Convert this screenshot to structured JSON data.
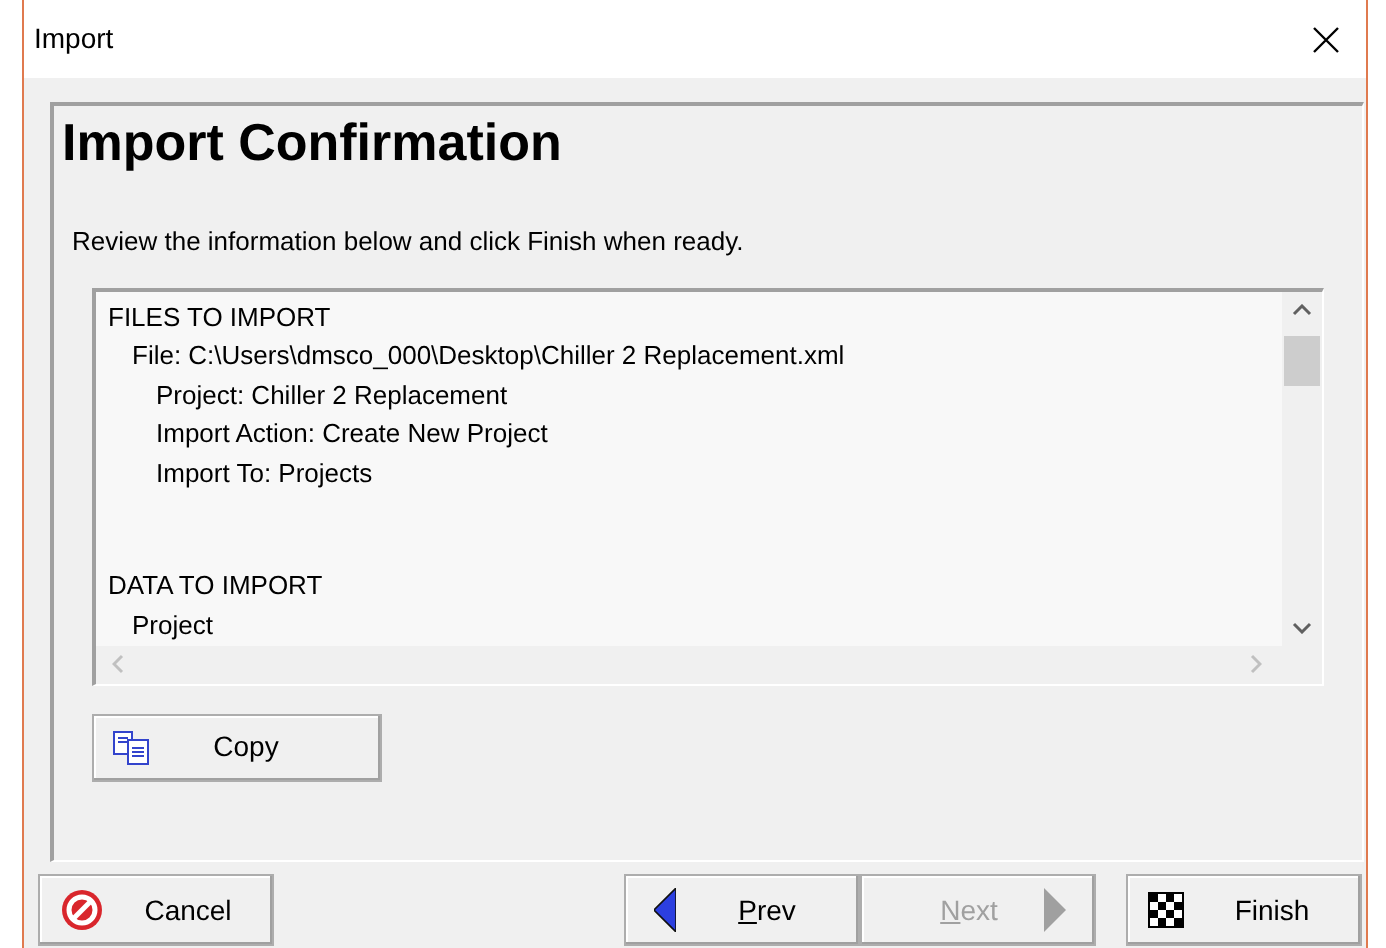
{
  "window": {
    "title": "Import"
  },
  "heading": "Import Confirmation",
  "instructions": "Review the information below and click Finish when ready.",
  "details": [
    {
      "text": "FILES TO IMPORT",
      "children": [
        {
          "text": "File: C:\\Users\\dmsco_000\\Desktop\\Chiller 2 Replacement.xml",
          "children": [
            {
              "text": "Project: Chiller 2 Replacement"
            },
            {
              "text": "Import Action: Create New Project"
            },
            {
              "text": "Import To: Projects"
            }
          ]
        }
      ]
    },
    {
      "text": "DATA TO IMPORT",
      "children": [
        {
          "text": "Project"
        }
      ]
    }
  ],
  "copy_button": {
    "label": "Copy"
  },
  "buttons": [
    {
      "kind": "cancel",
      "label": "Cancel",
      "disabled": false,
      "mnemonic_underlined": false
    },
    {
      "kind": "prev",
      "label": "Prev",
      "disabled": false,
      "mnemonic_underlined": true
    },
    {
      "kind": "next",
      "label": "Next",
      "disabled": true,
      "mnemonic_underlined": true
    },
    {
      "kind": "finish",
      "label": "Finish",
      "disabled": false,
      "mnemonic_underlined": false
    }
  ]
}
